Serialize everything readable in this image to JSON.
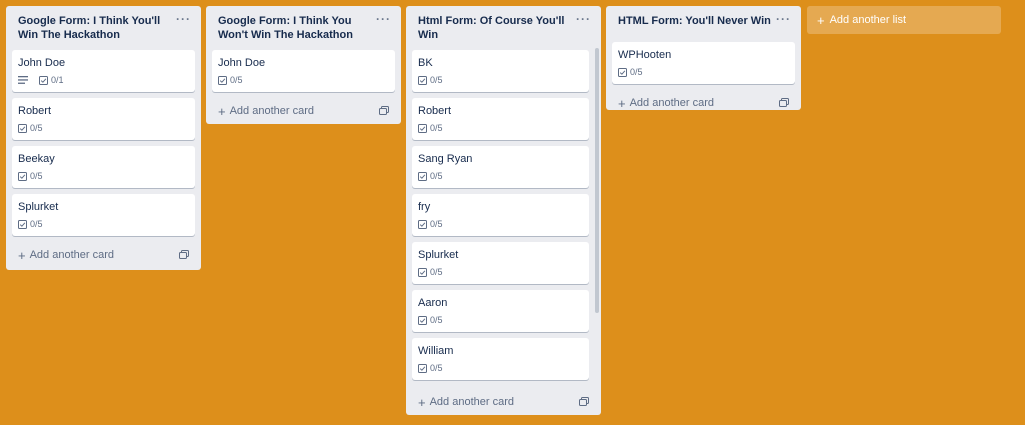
{
  "lists": [
    {
      "title": "Google Form: I Think You'll Win The Hackathon",
      "menu": "···",
      "cards": [
        {
          "title": "John Doe",
          "description_icon": "description-icon",
          "checklist": "0/1"
        },
        {
          "title": "Robert",
          "checklist": "0/5"
        },
        {
          "title": "Beekay",
          "checklist": "0/5"
        },
        {
          "title": "Splurket",
          "checklist": "0/5"
        }
      ],
      "add_card": "Add another card"
    },
    {
      "title": "Google Form: I Think You Won't Win The Hackathon",
      "menu": "···",
      "cards": [
        {
          "title": "John Doe",
          "checklist": "0/5"
        }
      ],
      "add_card": "Add another card"
    },
    {
      "title": "Html Form: Of Course You'll Win",
      "menu": "···",
      "cards": [
        {
          "title": "BK",
          "checklist": "0/5"
        },
        {
          "title": "Robert",
          "checklist": "0/5"
        },
        {
          "title": "Sang Ryan",
          "checklist": "0/5"
        },
        {
          "title": "fry",
          "checklist": "0/5"
        },
        {
          "title": "Splurket",
          "checklist": "0/5"
        },
        {
          "title": "Aaron",
          "checklist": "0/5"
        },
        {
          "title": "William",
          "checklist": "0/5"
        }
      ],
      "add_card": "Add another card"
    },
    {
      "title": "HTML Form: You'll Never Win",
      "menu": "···",
      "cards": [
        {
          "title": "WPHooten",
          "checklist": "0/5"
        }
      ],
      "add_card": "Add another card"
    }
  ],
  "add_list": "Add another list",
  "plus_glyph": "+",
  "colors": {
    "background": "#dd8f1b",
    "list": "#ebecf0",
    "card": "#ffffff"
  }
}
